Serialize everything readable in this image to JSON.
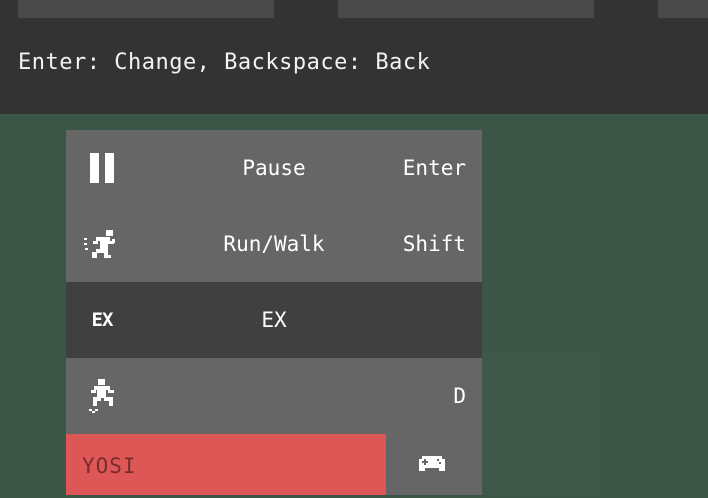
{
  "header": {
    "tabs": [
      "",
      "",
      ""
    ],
    "hint": "Enter: Change, Backspace: Back"
  },
  "menu": {
    "items": [
      {
        "icon": "pause-icon",
        "label": "Pause",
        "key": "Enter"
      },
      {
        "icon": "run-icon",
        "label": "Run/Walk",
        "key": "Shift"
      },
      {
        "icon": "ex-icon",
        "icon_text": "EX",
        "label": "EX",
        "key": ""
      },
      {
        "icon": "jump-icon",
        "label": "",
        "key": "D"
      }
    ],
    "selected_index": 2
  },
  "profile": {
    "name": "YOSI",
    "color": "#de5757",
    "device_icon": "gamepad-icon"
  }
}
